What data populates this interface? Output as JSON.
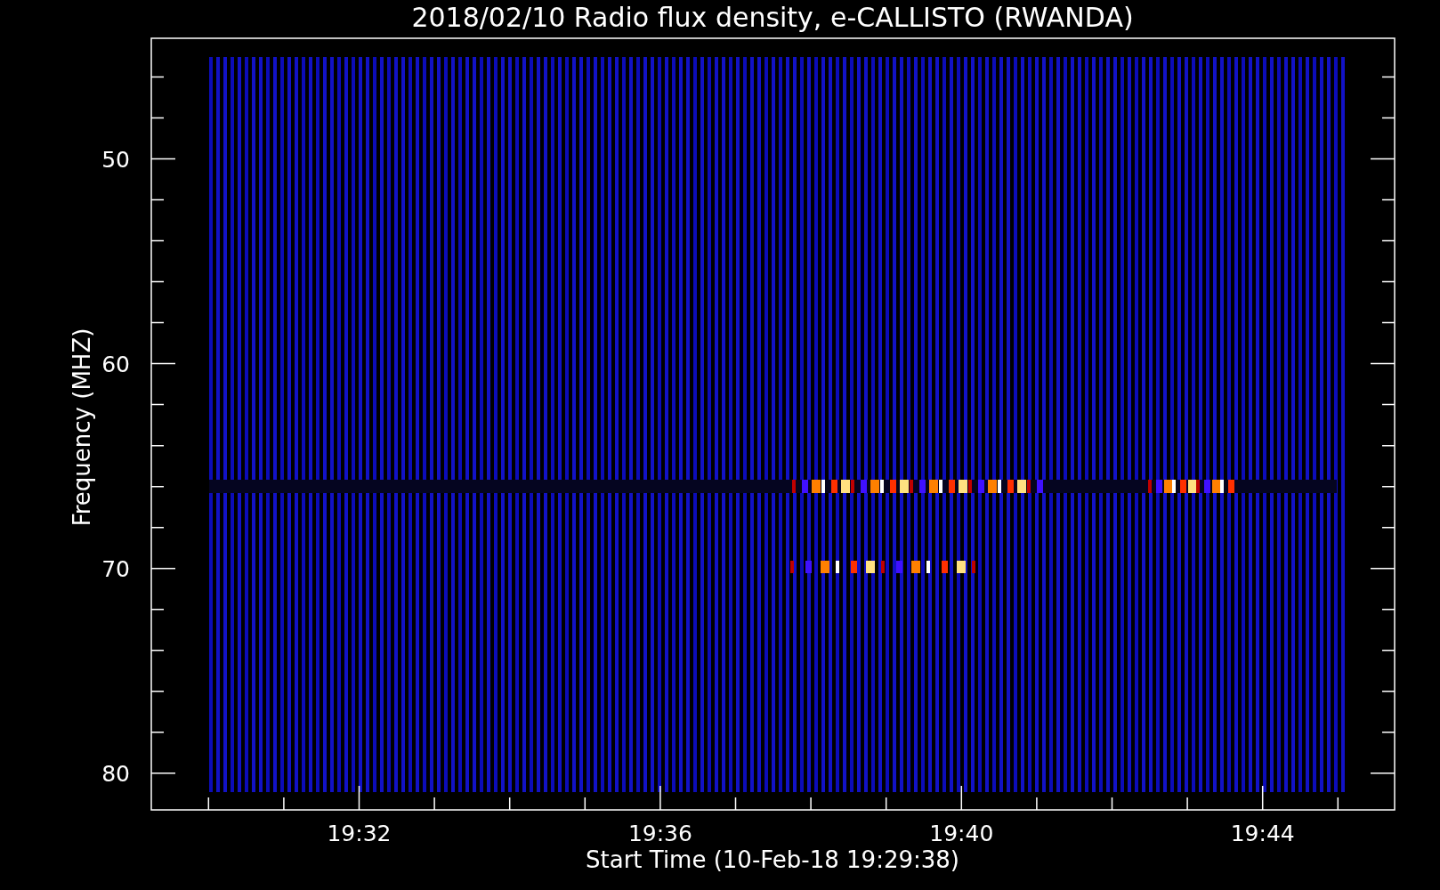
{
  "title": "2018/02/10  Radio flux density, e-CALLISTO (RWANDA)",
  "xlabel": "Start Time (10-Feb-18 19:29:38)",
  "ylabel": "Frequency (MHZ)",
  "xticks": [
    "19:32",
    "19:36",
    "19:40",
    "19:44"
  ],
  "yticks": [
    "50",
    "60",
    "70",
    "80"
  ]
}
